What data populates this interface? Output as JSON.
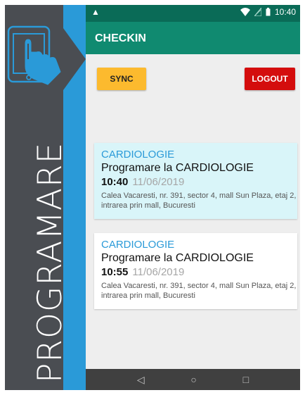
{
  "banner": {
    "text": "PROGRAMARE",
    "dark_color": "#4a4d52",
    "blue_color": "#2a9ad8",
    "icon": "tablet-touch-icon"
  },
  "status_bar": {
    "warning_glyph": "▲",
    "time": "10:40",
    "icons": [
      "wifi-icon",
      "signal-icon",
      "battery-icon"
    ],
    "color": "#0a6b57"
  },
  "app_bar": {
    "title": "CHECKIN",
    "color": "#108a70"
  },
  "actions": {
    "sync_label": "SYNC",
    "logout_label": "LOGOUT",
    "sync_color": "#fcba2e",
    "logout_color": "#d40d0d"
  },
  "appointments": [
    {
      "specialty": "CARDIOLOGIE",
      "title": "Programare la CARDIOLOGIE",
      "time": "10:40",
      "date": "11/06/2019",
      "address": "Calea Vacaresti, nr. 391, sector 4, mall Sun Plaza, etaj 2, intrarea prin mall, Bucuresti",
      "highlighted": true
    },
    {
      "specialty": "CARDIOLOGIE",
      "title": "Programare la CARDIOLOGIE",
      "time": "10:55",
      "date": "11/06/2019",
      "address": "Calea Vacaresti, nr. 391, sector 4, mall Sun Plaza, etaj 2, intrarea prin mall, Bucuresti",
      "highlighted": false
    }
  ],
  "nav": {
    "back": "◁",
    "home": "○",
    "recents": "□"
  }
}
